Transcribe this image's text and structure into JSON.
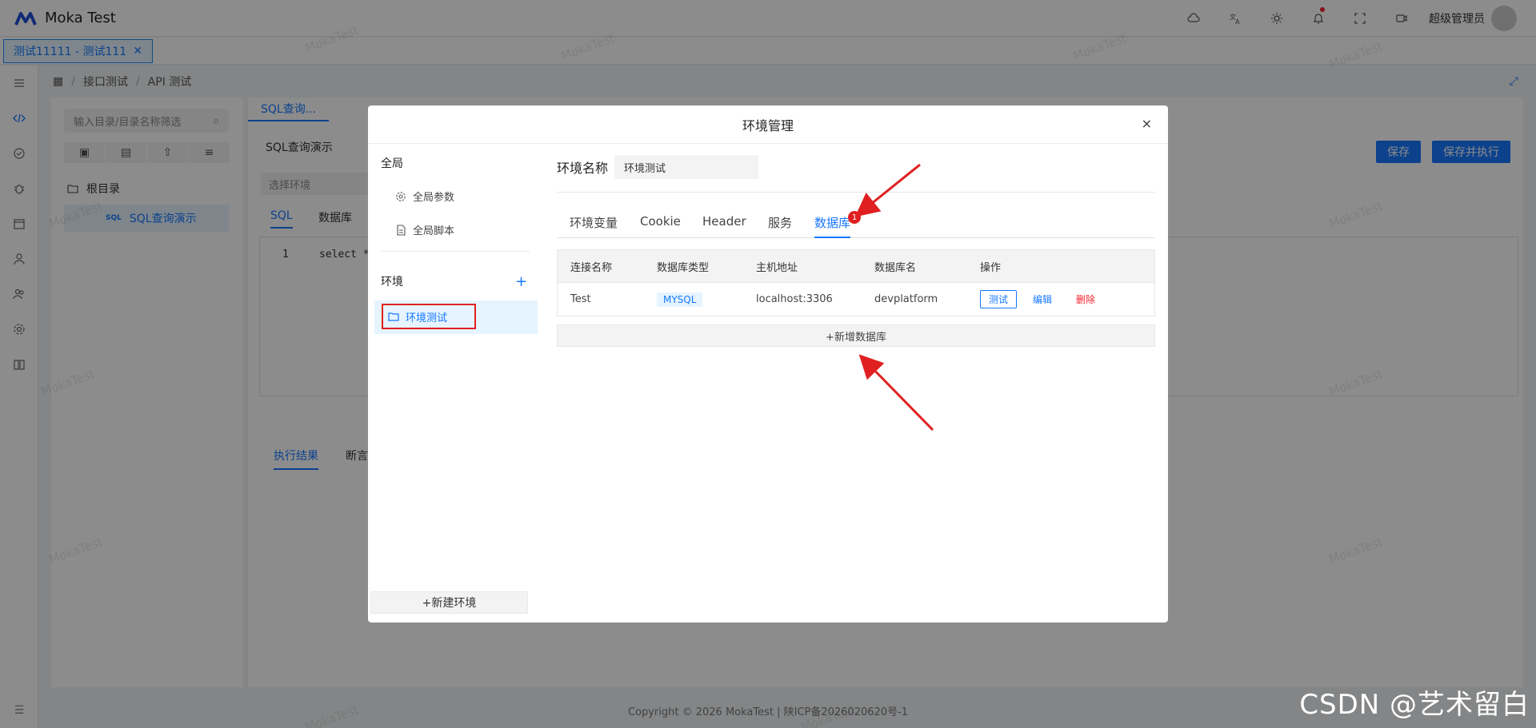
{
  "app": {
    "title": "Moka Test"
  },
  "header": {
    "user_name": "超级管理员"
  },
  "tabs": [
    {
      "label": "测试11111 - 测试111"
    }
  ],
  "breadcrumb": [
    "接口测试",
    "API 测试"
  ],
  "tree": {
    "search_placeholder": "输入目录/目录名称筛选",
    "root": "根目录",
    "node_prefix": "SQL",
    "node_label": "SQL查询演示"
  },
  "main": {
    "tab_label": "SQL查询...",
    "title": "SQL查询演示",
    "env_placeholder": "选择环境",
    "sub_tabs": [
      "SQL",
      "数据库"
    ],
    "line_number": "1",
    "code": "select * f",
    "save_label": "保存",
    "save_run_label": "保存并执行",
    "result_tabs": [
      "执行结果",
      "断言"
    ]
  },
  "modal": {
    "title": "环境管理",
    "close": "×",
    "left": {
      "global_section": "全局",
      "global_params": "全局参数",
      "global_script": "全局脚本",
      "env_section": "环境",
      "add": "+",
      "env_item": "环境测试",
      "new_env": "+新建环境"
    },
    "env_name_label": "环境名称",
    "env_name_value": "环境测试",
    "tabs": [
      "环境变量",
      "Cookie",
      "Header",
      "服务",
      "数据库"
    ],
    "active_tab": "数据库",
    "badge": "1",
    "table": {
      "headers": [
        "连接名称",
        "数据库类型",
        "主机地址",
        "数据库名",
        "操作"
      ],
      "rows": [
        {
          "name": "Test",
          "type": "MYSQL",
          "host": "localhost:3306",
          "db": "devplatform"
        }
      ],
      "actions": {
        "test": "测试",
        "edit": "编辑",
        "delete": "删除"
      }
    },
    "add_db": "+新增数据库"
  },
  "footer": {
    "copyright": "Copyright © 2026 MokaTest | 陕ICP备2026020620号-1"
  },
  "watermark_text": "MokaTest",
  "corner_watermark": "CSDN @艺术留白",
  "colors": {
    "primary": "#1677ff",
    "danger": "#f5222d",
    "annotation": "#e02020"
  }
}
